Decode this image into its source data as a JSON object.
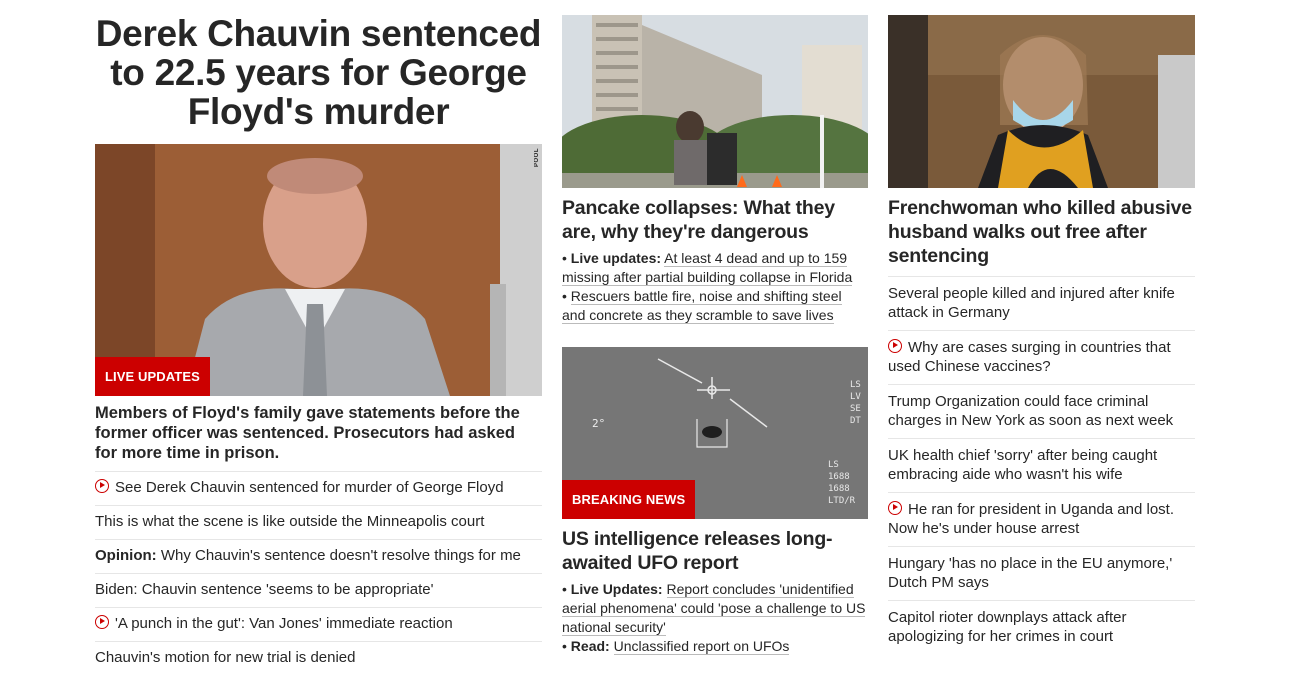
{
  "col1": {
    "headline": "Derek Chauvin sentenced to 22.5 years for George Floyd's murder",
    "badge": "LIVE UPDATES",
    "pool_credit": "POOL",
    "subhead": "Members of Floyd's family gave statements before the former officer was sentenced. Prosecutors had asked for more time in prison.",
    "links": [
      {
        "text": "See Derek Chauvin sentenced for murder of George Floyd",
        "video": true,
        "prefix": ""
      },
      {
        "text": "This is what the scene is like outside the Minneapolis court",
        "video": false,
        "prefix": ""
      },
      {
        "text": "Why Chauvin's sentence doesn't resolve things for me",
        "video": false,
        "prefix": "Opinion:"
      },
      {
        "text": "Biden: Chauvin sentence 'seems to be appropriate'",
        "video": false,
        "prefix": ""
      },
      {
        "text": "'A punch in the gut': Van Jones' immediate reaction",
        "video": true,
        "prefix": ""
      },
      {
        "text": "Chauvin's motion for new trial is denied",
        "video": false,
        "prefix": ""
      }
    ]
  },
  "col2": {
    "card1": {
      "headline": "Pancake collapses: What they are, why they're dangerous",
      "bullets": [
        {
          "prefix": "Live updates:",
          "text": "At least 4 dead and up to 159 missing after partial building collapse in Florida"
        },
        {
          "prefix": "",
          "text": "Rescuers battle fire, noise and shifting steel and concrete as they scramble to save lives"
        }
      ]
    },
    "card2": {
      "badge": "BREAKING NEWS",
      "overlay_text": "2°",
      "headline": "US intelligence releases long-awaited UFO report",
      "bullets": [
        {
          "prefix": "Live Updates:",
          "text": "Report concludes 'unidentified aerial phenomena' could 'pose a challenge to US national security'"
        },
        {
          "prefix": "Read:",
          "text": "Unclassified report on UFOs"
        }
      ]
    }
  },
  "col3": {
    "headline": "Frenchwoman who killed abusive husband walks out free after sentencing",
    "links": [
      {
        "text": "Several people killed and injured after knife attack in Germany",
        "video": false
      },
      {
        "text": "Why are cases surging in countries that used Chinese vaccines?",
        "video": true
      },
      {
        "text": "Trump Organization could face criminal charges in New York as soon as next week",
        "video": false
      },
      {
        "text": "UK health chief 'sorry' after being caught embracing aide who wasn't his wife",
        "video": false
      },
      {
        "text": "He ran for president in Uganda and lost. Now he's under house arrest",
        "video": true
      },
      {
        "text": "Hungary 'has no place in the EU anymore,' Dutch PM says",
        "video": false
      },
      {
        "text": "Capitol rioter downplays attack after apologizing for her crimes in court",
        "video": false
      }
    ]
  },
  "colors": {
    "accent_red": "#cc0000",
    "text": "#262626",
    "divider": "#e6e6e6"
  }
}
